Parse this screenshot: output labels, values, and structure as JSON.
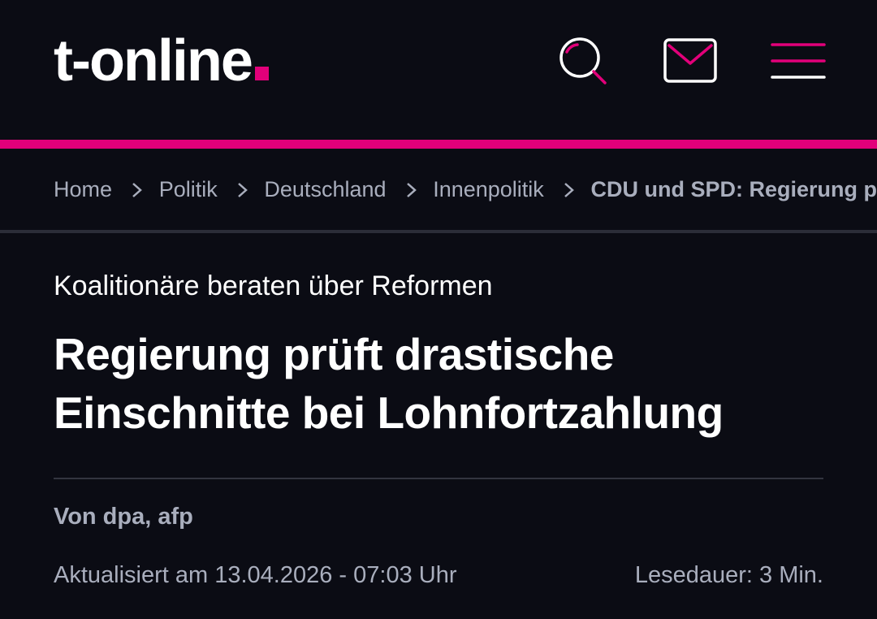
{
  "header": {
    "logo_text": "t-online",
    "accent_color": "#e2007a",
    "background_color": "#0b0c14",
    "icons": [
      "search-icon",
      "mail-icon",
      "menu-icon"
    ]
  },
  "breadcrumb": {
    "items": [
      "Home",
      "Politik",
      "Deutschland",
      "Innenpolitik"
    ],
    "current": "CDU und SPD: Regierung p"
  },
  "article": {
    "kicker": "Koalitionäre beraten über Reformen",
    "headline": "Regierung prüft drastische Einschnitte bei Lohnfortzahlung",
    "author": "Von dpa, afp",
    "updated": "Aktualisiert am 13.04.2026 - 07:03 Uhr",
    "reading_time": "Lesedauer: 3 Min."
  }
}
